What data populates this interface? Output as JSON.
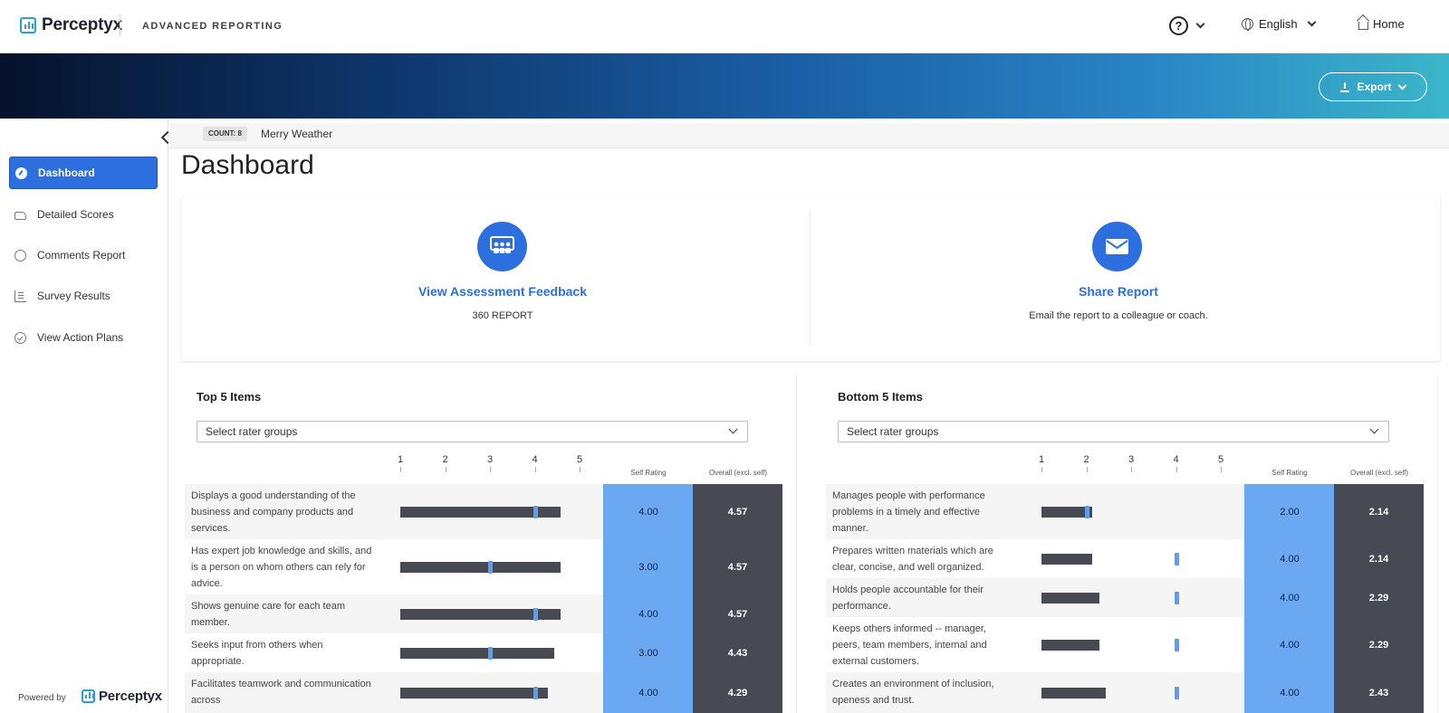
{
  "header": {
    "brand": "Perceptyx",
    "app_name": "ADVANCED REPORTING",
    "help_symbol": "?",
    "language": "English",
    "home": "Home"
  },
  "banner": {
    "export_label": "Export"
  },
  "sidebar": {
    "items": [
      {
        "label": "Dashboard",
        "icon": "dashboard-icon",
        "active": true
      },
      {
        "label": "Detailed Scores",
        "icon": "thumbs-up-icon"
      },
      {
        "label": "Comments Report",
        "icon": "comments-icon"
      },
      {
        "label": "Survey Results",
        "icon": "bar-chart-icon"
      },
      {
        "label": "View Action Plans",
        "icon": "check-circle-icon"
      }
    ],
    "powered_by": "Powered by",
    "powered_brand": "Perceptyx"
  },
  "context": {
    "count": "COUNT: 8",
    "person": "Merry Weather"
  },
  "page_title": "Dashboard",
  "cards": {
    "assessment": {
      "title": "View Assessment Feedback",
      "subtitle": "360 REPORT",
      "icon": "people-icon"
    },
    "share": {
      "title": "Share Report",
      "subtitle": "Email the report to a colleague or coach.",
      "icon": "envelope-icon"
    }
  },
  "top_items": {
    "title": "Top 5 Items",
    "select_placeholder": "Select rater groups",
    "scale": [
      "1",
      "2",
      "3",
      "4",
      "5"
    ],
    "self_label": "Self Rating",
    "overall_label": "Overall (excl. self)",
    "rows": [
      {
        "text": "Displays a good understanding of the business and company products and services.",
        "self": "4.00",
        "overall": "4.57",
        "bar": 4.57,
        "marker": 4.0
      },
      {
        "text": "Has expert job knowledge and skills, and is a person on whom others can rely for advice.",
        "self": "3.00",
        "overall": "4.57",
        "bar": 4.57,
        "marker": 3.0
      },
      {
        "text": "Shows genuine care for each team member.",
        "self": "4.00",
        "overall": "4.57",
        "bar": 4.57,
        "marker": 4.0
      },
      {
        "text": "Seeks input from others when appropriate.",
        "self": "3.00",
        "overall": "4.43",
        "bar": 4.43,
        "marker": 3.0
      },
      {
        "text": "Facilitates teamwork and communication across",
        "self": "4.00",
        "overall": "4.29",
        "bar": 4.29,
        "marker": 4.0
      }
    ]
  },
  "bottom_items": {
    "title": "Bottom 5 Items",
    "select_placeholder": "Select rater groups",
    "scale": [
      "1",
      "2",
      "3",
      "4",
      "5"
    ],
    "self_label": "Self Rating",
    "overall_label": "Overall (excl. self)",
    "rows": [
      {
        "text": "Manages people with performance problems in a timely and effective manner.",
        "self": "2.00",
        "overall": "2.14",
        "bar": 2.14,
        "marker": 2.0
      },
      {
        "text": "Prepares written materials which are clear, concise, and well organized.",
        "self": "4.00",
        "overall": "2.14",
        "bar": 2.14,
        "marker": 4.0
      },
      {
        "text": "Holds people accountable for their performance.",
        "self": "4.00",
        "overall": "2.29",
        "bar": 2.29,
        "marker": 4.0
      },
      {
        "text": "Keeps others informed -- manager, peers, team members, internal and external customers.",
        "self": "4.00",
        "overall": "2.29",
        "bar": 2.29,
        "marker": 4.0
      },
      {
        "text": "Creates an environment of inclusion, openess and trust.",
        "self": "4.00",
        "overall": "2.43",
        "bar": 2.43,
        "marker": 4.0
      }
    ]
  },
  "colors": {
    "accent": "#2d6fdf",
    "self_rating": "#6aa8f2",
    "overall": "#474953"
  }
}
